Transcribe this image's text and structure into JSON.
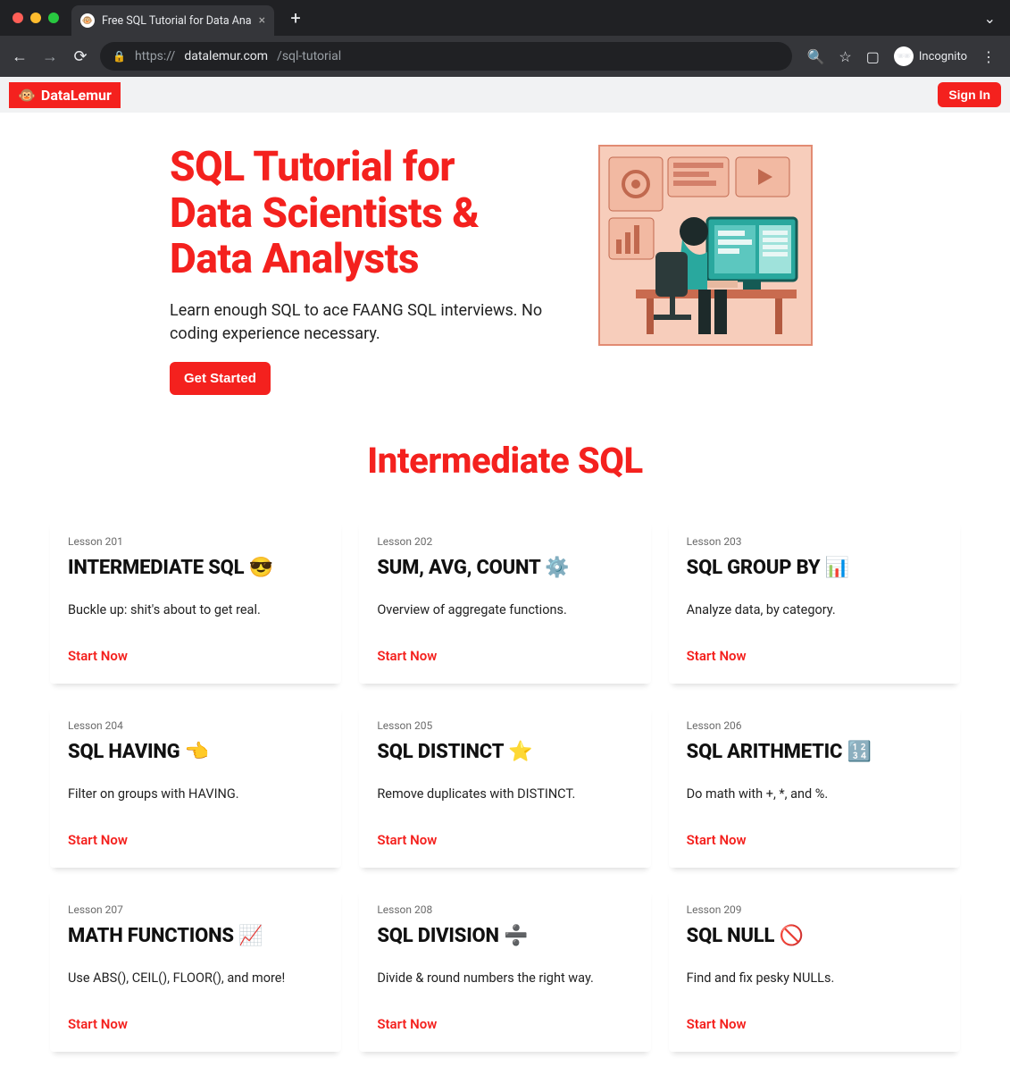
{
  "browser": {
    "tab_title": "Free SQL Tutorial for Data Ana",
    "url_display_prefix": "https://",
    "url_display_host": "datalemur.com",
    "url_display_path": "/sql-tutorial",
    "incognito_label": "Incognito"
  },
  "topbar": {
    "brand": "DataLemur",
    "signin_label": "Sign In"
  },
  "hero": {
    "title": "SQL Tutorial for Data Scientists & Data Analysts",
    "subtitle": "Learn enough SQL to ace FAANG SQL interviews. No coding experience necessary.",
    "cta_label": "Get Started"
  },
  "section": {
    "title": "Intermediate SQL"
  },
  "lessons": [
    {
      "no": "Lesson 201",
      "title": "INTERMEDIATE SQL 😎",
      "desc": "Buckle up: shit's about to get real.",
      "cta": "Start Now"
    },
    {
      "no": "Lesson 202",
      "title": "SUM, AVG, COUNT ⚙️",
      "desc": "Overview of aggregate functions.",
      "cta": "Start Now"
    },
    {
      "no": "Lesson 203",
      "title": "SQL GROUP BY 📊",
      "desc": "Analyze data, by category.",
      "cta": "Start Now"
    },
    {
      "no": "Lesson 204",
      "title": "SQL HAVING 👈",
      "desc": "Filter on groups with HAVING.",
      "cta": "Start Now"
    },
    {
      "no": "Lesson 205",
      "title": "SQL DISTINCT ⭐",
      "desc": "Remove duplicates with DISTINCT.",
      "cta": "Start Now"
    },
    {
      "no": "Lesson 206",
      "title": "SQL ARITHMETIC 🔢",
      "desc": "Do math with +, *, and %.",
      "cta": "Start Now"
    },
    {
      "no": "Lesson 207",
      "title": "MATH FUNCTIONS 📈",
      "desc": "Use ABS(), CEIL(), FLOOR(), and more!",
      "cta": "Start Now"
    },
    {
      "no": "Lesson 208",
      "title": "SQL DIVISION ➗",
      "desc": "Divide & round numbers the right way.",
      "cta": "Start Now"
    },
    {
      "no": "Lesson 209",
      "title": "SQL NULL 🚫",
      "desc": "Find and fix pesky NULLs.",
      "cta": "Start Now"
    }
  ]
}
